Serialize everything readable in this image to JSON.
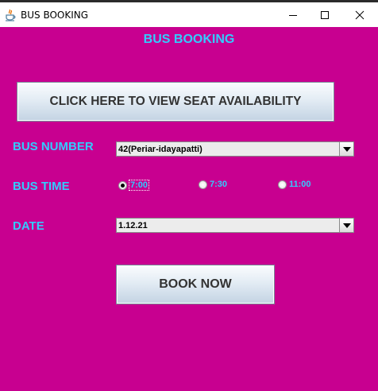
{
  "window": {
    "title": "BUS BOOKING",
    "icon": "java-cup-icon",
    "background_color": "#c80090"
  },
  "form": {
    "heading": "BUS BOOKING",
    "view_seats_button": "CLICK HERE TO VIEW SEAT AVAILABILITY",
    "bus_number": {
      "label": "BUS NUMBER",
      "selected": "42(Periar-idayapatti)"
    },
    "bus_time": {
      "label": "BUS TIME",
      "options": [
        "7:00",
        "7:30",
        "11:00"
      ],
      "selected_index": 0
    },
    "date": {
      "label": "DATE",
      "selected": "1.12.21"
    },
    "book_button": "BOOK NOW"
  },
  "colors": {
    "label_text": "#33ccff",
    "button_text": "#333333"
  }
}
